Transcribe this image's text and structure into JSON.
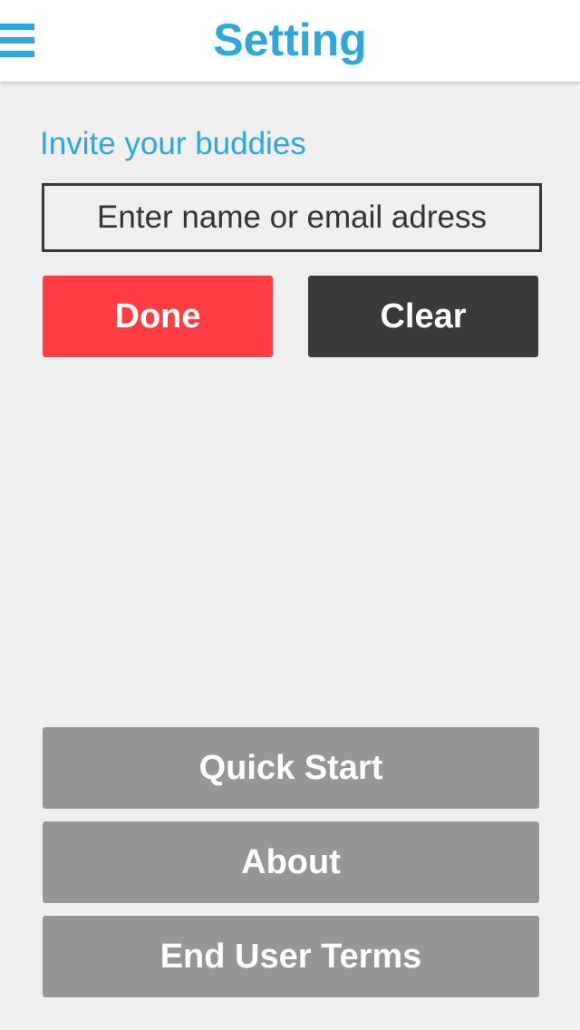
{
  "header": {
    "title": "Setting",
    "menu_icon": "hamburger-menu-icon",
    "accent_color": "#2ea8dc"
  },
  "invite": {
    "label": "Invite your buddies",
    "input_placeholder": "Enter name or email adress",
    "input_value": ""
  },
  "actions": {
    "done_label": "Done",
    "clear_label": "Clear",
    "done_color": "#ff3c41",
    "clear_color": "#3a3a3a"
  },
  "bottom_menu": {
    "quick_start_label": "Quick Start",
    "about_label": "About",
    "end_user_terms_label": "End User Terms",
    "button_color": "#969696"
  }
}
